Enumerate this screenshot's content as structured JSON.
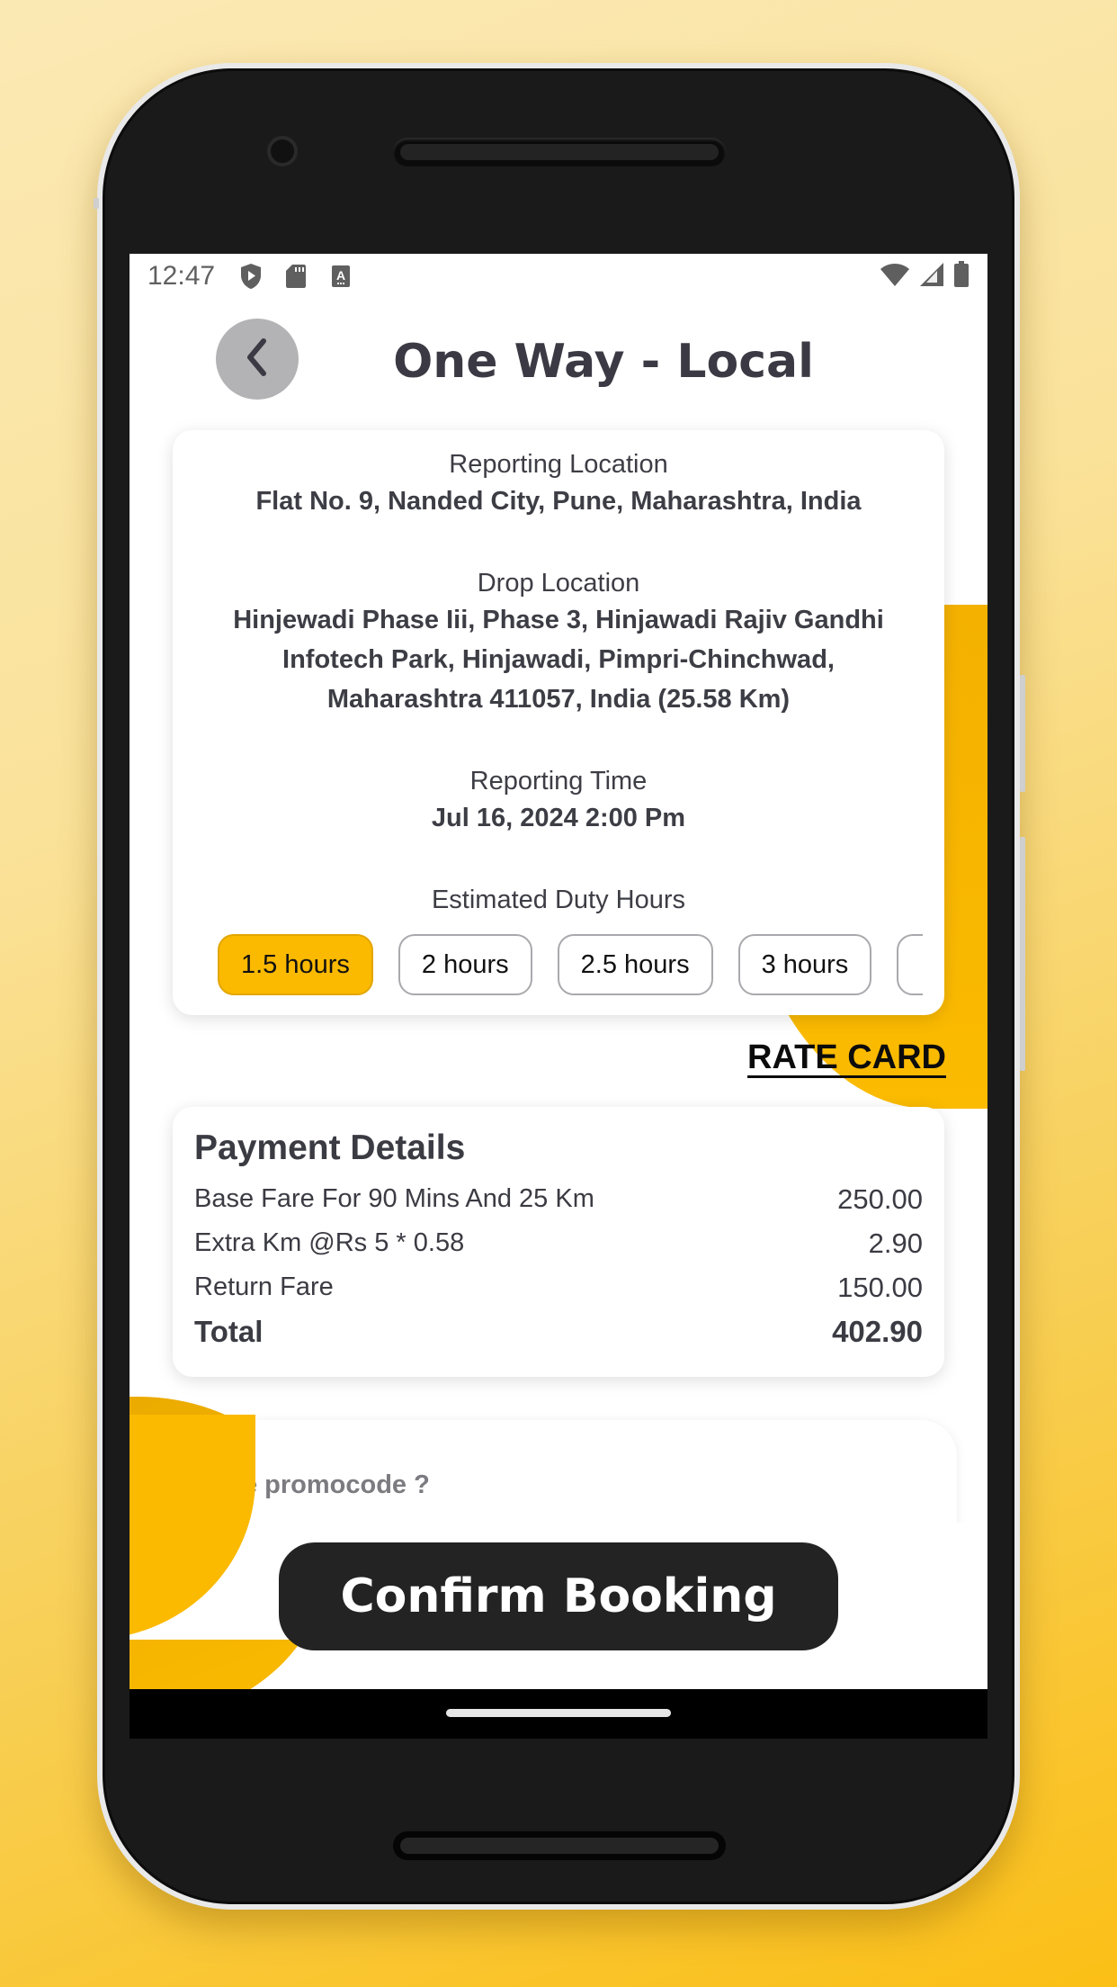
{
  "status_bar": {
    "time": "12:47",
    "left_icons": [
      "play-protect-icon",
      "sd-card-icon",
      "keyboard-a-icon"
    ],
    "right_icons": [
      "wifi-icon",
      "signal-icon",
      "battery-icon"
    ]
  },
  "header": {
    "back_icon": "chevron-left-icon",
    "title": "One Way - Local"
  },
  "trip": {
    "reporting_location_label": "Reporting Location",
    "reporting_location": "Flat No. 9, Nanded City, Pune, Maharashtra, India",
    "drop_location_label": "Drop Location",
    "drop_location_line1": "Hinjewadi Phase Iii, Phase 3, Hinjawadi Rajiv Gandhi",
    "drop_location_line2": "Infotech Park, Hinjawadi, Pimpri-Chinchwad,",
    "drop_location_line3": "Maharashtra 411057, India (25.58 Km)",
    "reporting_time_label": "Reporting Time",
    "reporting_time": "Jul 16, 2024 2:00 Pm",
    "duty_hours_label": "Estimated Duty Hours",
    "duty_hours_options": [
      {
        "label": "1.5 hours",
        "selected": true
      },
      {
        "label": "2 hours",
        "selected": false
      },
      {
        "label": "2.5 hours",
        "selected": false
      },
      {
        "label": "3 hours",
        "selected": false
      },
      {
        "label": "",
        "selected": false
      }
    ]
  },
  "rate_card_label": "RATE CARD",
  "payment": {
    "title": "Payment Details",
    "rows": [
      {
        "label": "Base Fare For 90 Mins And 25 Km",
        "amount": "250.00"
      },
      {
        "label": "Extra Km @Rs 5 * 0.58",
        "amount": "2.90"
      },
      {
        "label": "Return Fare",
        "amount": "150.00"
      }
    ],
    "total_label": "Total",
    "total_amount": "402.90"
  },
  "promo": {
    "text": "have promocode ?"
  },
  "confirm_label": "Confirm Booking",
  "colors": {
    "accent": "#fbb900",
    "text_dark": "#3b3a44",
    "button_dark": "#232323"
  }
}
